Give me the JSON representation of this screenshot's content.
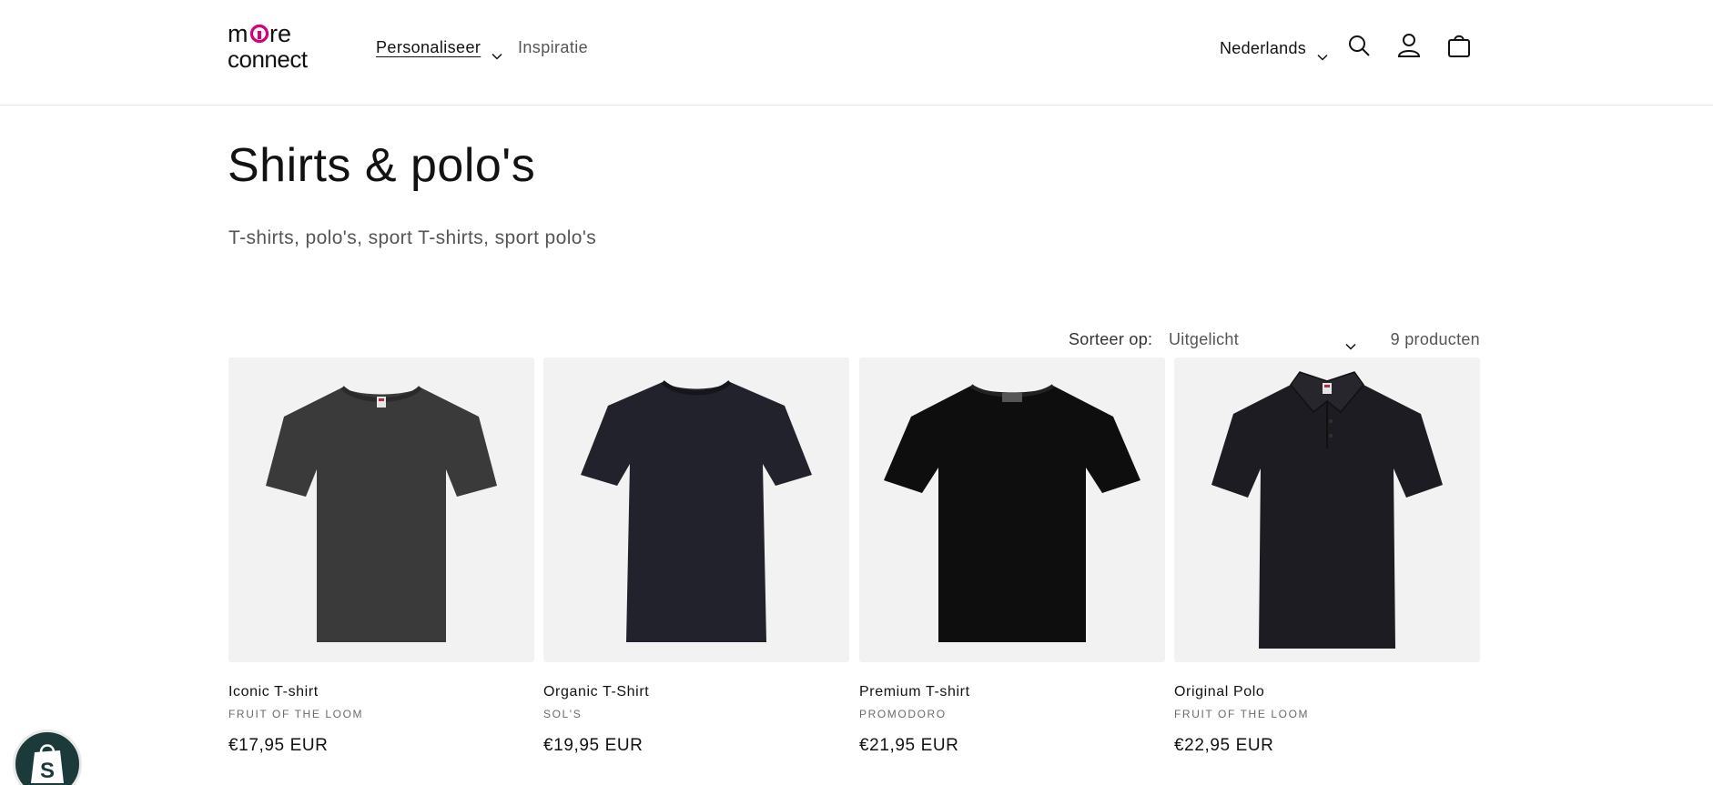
{
  "header": {
    "logo_alt": "more connect",
    "nav": [
      {
        "label": "Personaliseer",
        "has_dropdown": true,
        "icon": "chevron-down-icon"
      },
      {
        "label": "Inspiratie",
        "has_dropdown": false
      }
    ],
    "language": {
      "label": "Nederlands",
      "icon": "chevron-down-icon"
    },
    "icons": [
      "search-icon",
      "account-icon",
      "cart-icon"
    ]
  },
  "collection": {
    "title": "Shirts & polo's",
    "description": "T-shirts, polo's, sport T-shirts, sport polo's"
  },
  "sorting": {
    "label": "Sorteer op:",
    "selected": "Uitgelicht",
    "product_count": "9 producten"
  },
  "products": [
    {
      "name": "Iconic T-shirt",
      "vendor": "FRUIT OF THE LOOM",
      "price": "€17,95 EUR",
      "image": "tshirt-icon",
      "color": "#3a3a3a"
    },
    {
      "name": "Organic T-Shirt",
      "vendor": "SOL'S",
      "price": "€19,95 EUR",
      "image": "tshirt-icon",
      "color": "#22222c"
    },
    {
      "name": "Premium T-shirt",
      "vendor": "PROMODORO",
      "price": "€21,95 EUR",
      "image": "tshirt-icon",
      "color": "#0e0e0e"
    },
    {
      "name": "Original Polo",
      "vendor": "FRUIT OF THE LOOM",
      "price": "€22,95 EUR",
      "image": "polo-icon",
      "color": "#1c1c22"
    }
  ],
  "colors": {
    "brand_magenta": "#d6007a",
    "text": "#121212",
    "muted": "#555555",
    "card_bg": "#f2f2f2",
    "shopify_badge": "#1d3a3a"
  }
}
